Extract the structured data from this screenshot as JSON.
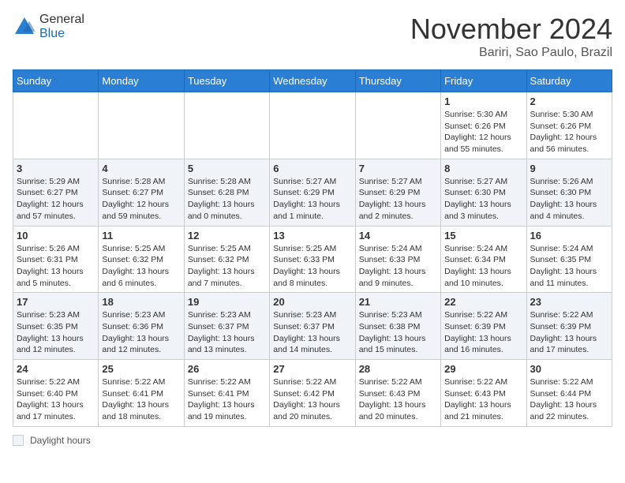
{
  "header": {
    "logo_general": "General",
    "logo_blue": "Blue",
    "month_title": "November 2024",
    "location": "Bariri, Sao Paulo, Brazil"
  },
  "legend": {
    "label": "Daylight hours"
  },
  "days_of_week": [
    "Sunday",
    "Monday",
    "Tuesday",
    "Wednesday",
    "Thursday",
    "Friday",
    "Saturday"
  ],
  "weeks": [
    {
      "row": 1,
      "cells": [
        {
          "day": null,
          "info": null
        },
        {
          "day": null,
          "info": null
        },
        {
          "day": null,
          "info": null
        },
        {
          "day": null,
          "info": null
        },
        {
          "day": null,
          "info": null
        },
        {
          "day": "1",
          "info": "Sunrise: 5:30 AM\nSunset: 6:26 PM\nDaylight: 12 hours\nand 55 minutes."
        },
        {
          "day": "2",
          "info": "Sunrise: 5:30 AM\nSunset: 6:26 PM\nDaylight: 12 hours\nand 56 minutes."
        }
      ]
    },
    {
      "row": 2,
      "cells": [
        {
          "day": "3",
          "info": "Sunrise: 5:29 AM\nSunset: 6:27 PM\nDaylight: 12 hours\nand 57 minutes."
        },
        {
          "day": "4",
          "info": "Sunrise: 5:28 AM\nSunset: 6:27 PM\nDaylight: 12 hours\nand 59 minutes."
        },
        {
          "day": "5",
          "info": "Sunrise: 5:28 AM\nSunset: 6:28 PM\nDaylight: 13 hours\nand 0 minutes."
        },
        {
          "day": "6",
          "info": "Sunrise: 5:27 AM\nSunset: 6:29 PM\nDaylight: 13 hours\nand 1 minute."
        },
        {
          "day": "7",
          "info": "Sunrise: 5:27 AM\nSunset: 6:29 PM\nDaylight: 13 hours\nand 2 minutes."
        },
        {
          "day": "8",
          "info": "Sunrise: 5:27 AM\nSunset: 6:30 PM\nDaylight: 13 hours\nand 3 minutes."
        },
        {
          "day": "9",
          "info": "Sunrise: 5:26 AM\nSunset: 6:30 PM\nDaylight: 13 hours\nand 4 minutes."
        }
      ]
    },
    {
      "row": 3,
      "cells": [
        {
          "day": "10",
          "info": "Sunrise: 5:26 AM\nSunset: 6:31 PM\nDaylight: 13 hours\nand 5 minutes."
        },
        {
          "day": "11",
          "info": "Sunrise: 5:25 AM\nSunset: 6:32 PM\nDaylight: 13 hours\nand 6 minutes."
        },
        {
          "day": "12",
          "info": "Sunrise: 5:25 AM\nSunset: 6:32 PM\nDaylight: 13 hours\nand 7 minutes."
        },
        {
          "day": "13",
          "info": "Sunrise: 5:25 AM\nSunset: 6:33 PM\nDaylight: 13 hours\nand 8 minutes."
        },
        {
          "day": "14",
          "info": "Sunrise: 5:24 AM\nSunset: 6:33 PM\nDaylight: 13 hours\nand 9 minutes."
        },
        {
          "day": "15",
          "info": "Sunrise: 5:24 AM\nSunset: 6:34 PM\nDaylight: 13 hours\nand 10 minutes."
        },
        {
          "day": "16",
          "info": "Sunrise: 5:24 AM\nSunset: 6:35 PM\nDaylight: 13 hours\nand 11 minutes."
        }
      ]
    },
    {
      "row": 4,
      "cells": [
        {
          "day": "17",
          "info": "Sunrise: 5:23 AM\nSunset: 6:35 PM\nDaylight: 13 hours\nand 12 minutes."
        },
        {
          "day": "18",
          "info": "Sunrise: 5:23 AM\nSunset: 6:36 PM\nDaylight: 13 hours\nand 12 minutes."
        },
        {
          "day": "19",
          "info": "Sunrise: 5:23 AM\nSunset: 6:37 PM\nDaylight: 13 hours\nand 13 minutes."
        },
        {
          "day": "20",
          "info": "Sunrise: 5:23 AM\nSunset: 6:37 PM\nDaylight: 13 hours\nand 14 minutes."
        },
        {
          "day": "21",
          "info": "Sunrise: 5:23 AM\nSunset: 6:38 PM\nDaylight: 13 hours\nand 15 minutes."
        },
        {
          "day": "22",
          "info": "Sunrise: 5:22 AM\nSunset: 6:39 PM\nDaylight: 13 hours\nand 16 minutes."
        },
        {
          "day": "23",
          "info": "Sunrise: 5:22 AM\nSunset: 6:39 PM\nDaylight: 13 hours\nand 17 minutes."
        }
      ]
    },
    {
      "row": 5,
      "cells": [
        {
          "day": "24",
          "info": "Sunrise: 5:22 AM\nSunset: 6:40 PM\nDaylight: 13 hours\nand 17 minutes."
        },
        {
          "day": "25",
          "info": "Sunrise: 5:22 AM\nSunset: 6:41 PM\nDaylight: 13 hours\nand 18 minutes."
        },
        {
          "day": "26",
          "info": "Sunrise: 5:22 AM\nSunset: 6:41 PM\nDaylight: 13 hours\nand 19 minutes."
        },
        {
          "day": "27",
          "info": "Sunrise: 5:22 AM\nSunset: 6:42 PM\nDaylight: 13 hours\nand 20 minutes."
        },
        {
          "day": "28",
          "info": "Sunrise: 5:22 AM\nSunset: 6:43 PM\nDaylight: 13 hours\nand 20 minutes."
        },
        {
          "day": "29",
          "info": "Sunrise: 5:22 AM\nSunset: 6:43 PM\nDaylight: 13 hours\nand 21 minutes."
        },
        {
          "day": "30",
          "info": "Sunrise: 5:22 AM\nSunset: 6:44 PM\nDaylight: 13 hours\nand 22 minutes."
        }
      ]
    }
  ]
}
